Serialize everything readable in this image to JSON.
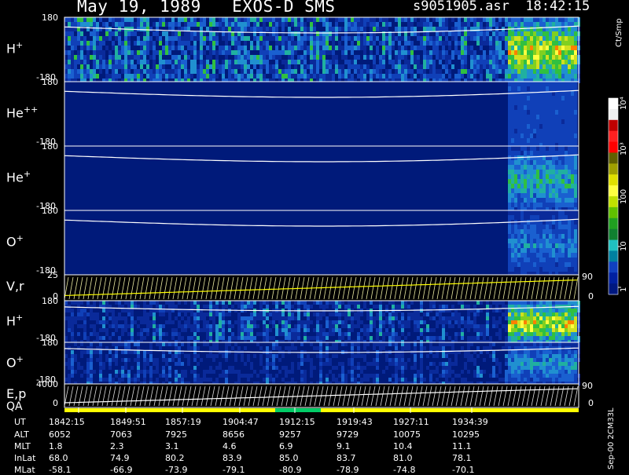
{
  "header": {
    "title": "May 19, 1989   EXOS-D SMS",
    "file": "s9051905.asr",
    "time": "18:42:15"
  },
  "panels": [
    {
      "id": "h1",
      "label": "H",
      "sup": "+",
      "ytop": "180",
      "ybot": "-180",
      "kind": "spectrogram",
      "bright": 0.45,
      "hot": 0.95
    },
    {
      "id": "hepp",
      "label": "He",
      "sup": "++",
      "ytop": "180",
      "ybot": "-180",
      "kind": "spectrogram",
      "bright": 0.05,
      "hot": 0.25
    },
    {
      "id": "hep",
      "label": "He",
      "sup": "+",
      "ytop": "180",
      "ybot": "-180",
      "kind": "spectrogram",
      "bright": 0.02,
      "hot": 0.6
    },
    {
      "id": "op",
      "label": "O",
      "sup": "+",
      "ytop": "180",
      "ybot": "-180",
      "kind": "spectrogram",
      "bright": 0.02,
      "hot": 0.45
    },
    {
      "id": "vr",
      "label": "V,r",
      "ytop": "25",
      "ybot": "0",
      "right_top": "90",
      "right_bot": "0",
      "kind": "lines"
    },
    {
      "id": "h2",
      "label": "H",
      "sup": "+",
      "ytop": "180",
      "ybot": "-180",
      "kind": "stripes",
      "bright": 0.4,
      "hot": 0.95
    },
    {
      "id": "o2",
      "label": "O",
      "sup": "+",
      "ytop": "180",
      "ybot": "-180",
      "kind": "stripes",
      "bright": 0.3,
      "hot": 0.5
    },
    {
      "id": "ep",
      "label": "E,p",
      "ytop": "4000",
      "ybot": "0",
      "right_top": "90",
      "right_bot": "0",
      "kind": "lines"
    }
  ],
  "qa_label": "QA",
  "colorbar": {
    "label": "Ct/Smp",
    "ticks": [
      "1",
      "10",
      "100",
      "10³",
      "10⁴"
    ]
  },
  "footer_stamp": "Sep-00 2CM33L",
  "table": {
    "rows": [
      {
        "name": "UT",
        "values": [
          "1842:15",
          "1849:51",
          "1857:19",
          "1904:47",
          "1912:15",
          "1919:43",
          "1927:11",
          "1934:39"
        ]
      },
      {
        "name": "ALT",
        "values": [
          "6052",
          "7063",
          "7925",
          "8656",
          "9257",
          "9729",
          "10075",
          "10295"
        ]
      },
      {
        "name": "MLT",
        "values": [
          "1.8",
          "2.3",
          "3.1",
          "4.6",
          "6.9",
          "9.1",
          "10.4",
          "11.1"
        ]
      },
      {
        "name": "InLat",
        "values": [
          "68.0",
          "74.9",
          "80.2",
          "83.9",
          "85.0",
          "83.7",
          "81.0",
          "78.1"
        ]
      },
      {
        "name": "MLat",
        "values": [
          "-58.1",
          "-66.9",
          "-73.9",
          "-79.1",
          "-80.9",
          "-78.9",
          "-74.8",
          "-70.1"
        ]
      }
    ]
  },
  "colors": {
    "background": "#000000",
    "base_blue": "#001a7a",
    "qa_yellow": "#ffff00",
    "qa_green": "#00cc66"
  }
}
